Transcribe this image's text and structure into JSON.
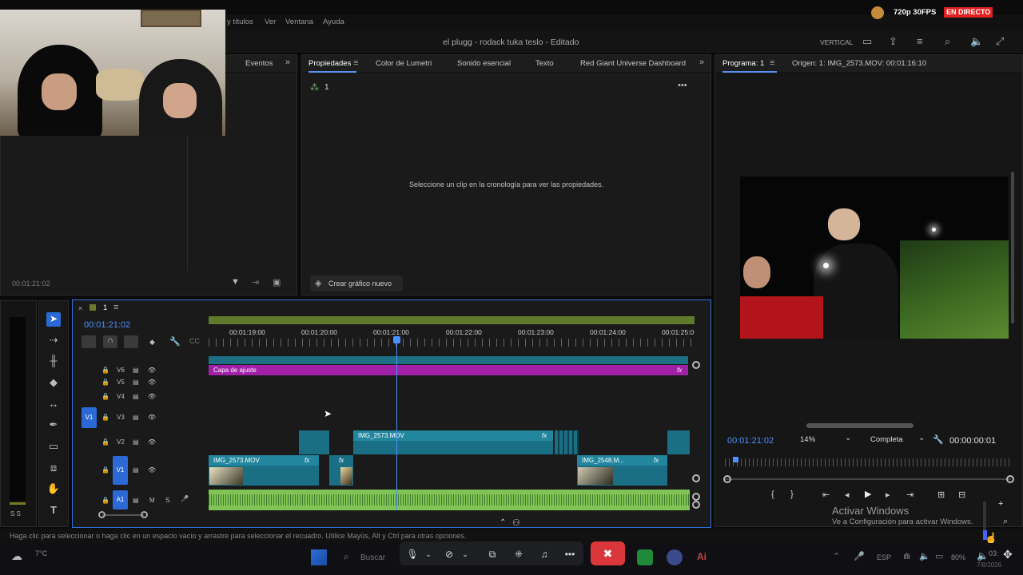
{
  "stream": {
    "quality": "720p 30FPS",
    "live": "EN DIRECTO"
  },
  "menu": {
    "items": [
      "y títulos",
      "Ver",
      "Ventana",
      "Ayuda"
    ]
  },
  "title": {
    "project": "el plugg - rodack tuka teslo - Editado",
    "layout": "VERTICAL"
  },
  "left_panel": {
    "tab": "Eventos",
    "timecode": "00:01:21:02"
  },
  "props_panel": {
    "tabs": [
      "Propiedades",
      "Color de Lumetri",
      "Sonido esencial",
      "Texto",
      "Red Giant Universe Dashboard"
    ],
    "seq_number": "1",
    "empty_msg": "Seleccione un clip en la cronología para ver las propiedades.",
    "create_btn": "Crear gráfico nuevo"
  },
  "program": {
    "tab": "Programa: 1",
    "source": "Origen: 1: IMG_2573.MOV: 00:01:16:10",
    "timecode": "00:01:21:02",
    "zoom": "14%",
    "quality": "Completa",
    "duration": "00:00:00:01"
  },
  "timeline": {
    "seq": "1",
    "timecode": "00:01:21:02",
    "ruler": [
      "00:01:19:00",
      "00:01:20:00",
      "00:01:21:00",
      "00:01:22:00",
      "00:01:23:00",
      "00:01:24:00",
      "00:01:25:0"
    ],
    "tracks": [
      "V6",
      "V5",
      "V4",
      "V3",
      "V2",
      "V1",
      "A1"
    ],
    "track_letters": {
      "v1": "V1",
      "m": "M",
      "s": "S"
    },
    "clips": {
      "adjust": "Capa de ajuste",
      "v2": "IMG_2573.MOV",
      "v1a": "IMG_2573.MOV",
      "v1b": "IMG_2548.M...",
      "fx": "fx"
    }
  },
  "audio_meter": {
    "label": "S S"
  },
  "status": "Haga clic para seleccionar o haga clic en un espacio vacío y arrastre para seleccionar el recuadro. Utilice Mayús, Alt y Ctrl para otras opciones.",
  "watermark": {
    "line1": "Activar Windows",
    "line2": "Ve a Configuración para activar Windows."
  },
  "taskbar": {
    "temp": "7°C",
    "search": "Buscar",
    "lang": "ESP",
    "battery": "80%",
    "clock": "03:",
    "date": "7/8/2026"
  }
}
